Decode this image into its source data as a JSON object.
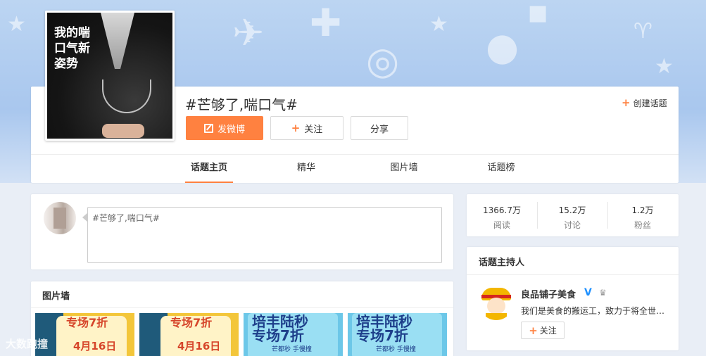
{
  "header": {
    "cover_text": "我的喘口气新姿势",
    "topic_title": "#芒够了,喘口气#",
    "create_topic": "创建话题",
    "post_button": "发微博",
    "follow_button": "关注",
    "share_button": "分享"
  },
  "tabs": [
    {
      "label": "话题主页",
      "active": true
    },
    {
      "label": "精华",
      "active": false
    },
    {
      "label": "图片墙",
      "active": false
    },
    {
      "label": "话题榜",
      "active": false
    }
  ],
  "post_box": {
    "value": "#芒够了,喘口气#"
  },
  "picture_wall": {
    "title": "图片墙",
    "thumbs": [
      {
        "line1": "专场7折",
        "line2": "4月16日",
        "style": "yellow"
      },
      {
        "line1": "专场7折",
        "line2": "4月16日",
        "style": "yellow"
      },
      {
        "line1": "培丰陆秒",
        "line2": "专场7折",
        "line3": "芒都秒 手慢撞",
        "style": "blue"
      },
      {
        "line1": "培丰陆秒",
        "line2": "专场7折",
        "line3": "芒都秒 手慢撞",
        "style": "blue"
      }
    ]
  },
  "watermark": "大数跑撞",
  "stats": [
    {
      "value": "1366.7万",
      "label": "阅读"
    },
    {
      "value": "15.2万",
      "label": "讨论"
    },
    {
      "value": "1.2万",
      "label": "粉丝"
    }
  ],
  "host": {
    "title": "话题主持人",
    "name": "良品铺子美食",
    "verified": "V",
    "description": "我们是美食的搬运工，致力于将全世…",
    "follow": "关注"
  },
  "colors": {
    "accent": "#ff8140",
    "banner": "#a9c7ee",
    "verified": "#1e90ff"
  }
}
